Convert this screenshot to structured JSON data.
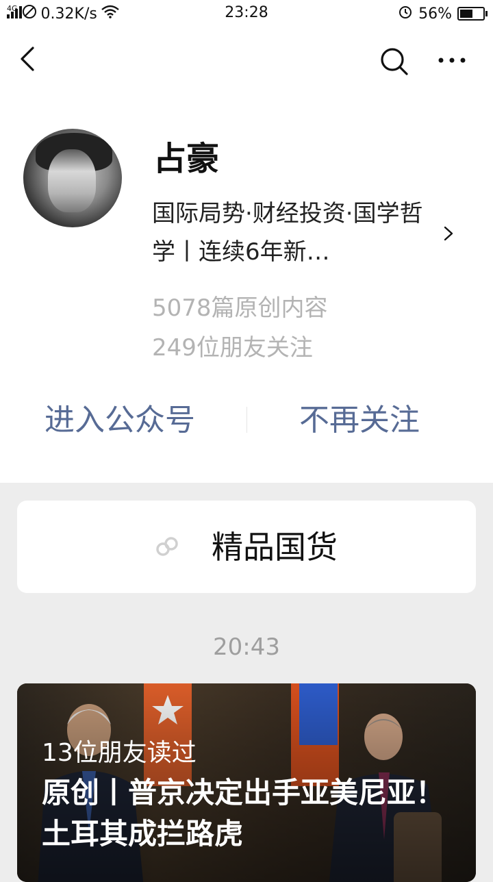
{
  "status_bar": {
    "network": "4G",
    "speed": "0.32K/s",
    "time": "23:28",
    "battery": "56%",
    "battery_level": 0.56
  },
  "nav": {
    "back_icon": "chevron-left-icon",
    "search_icon": "search-icon",
    "more_icon": "more-icon"
  },
  "profile": {
    "name": "占豪",
    "description": "国际局势·财经投资·国学哲学丨连续6年新…",
    "articles": "5078篇原创内容",
    "followers": "249位朋友关注"
  },
  "actions": {
    "enter_label": "进入公众号",
    "unfollow_label": "不再关注"
  },
  "mini_program": {
    "label": "精品国货",
    "icon": "mini-program-icon"
  },
  "feed": {
    "timestamp": "20:43",
    "article": {
      "read_by": "13位朋友读过",
      "title": "原创丨普京决定出手亚美尼亚！土耳其成拦路虎"
    }
  },
  "colors": {
    "link": "#576b95",
    "muted": "#b3b3b3",
    "background": "#ededed"
  }
}
